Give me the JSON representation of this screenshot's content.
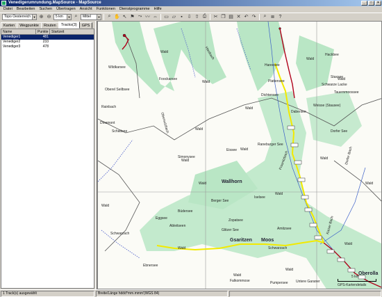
{
  "window": {
    "title": "Venedigerumrundung.MapSource - MapSource",
    "buttons": [
      "_",
      "□",
      "×"
    ]
  },
  "menu": [
    "Datei",
    "Bearbeiten",
    "Suchen",
    "Übertragen",
    "Ansicht",
    "Funktionen",
    "Dienstprogramme",
    "Hilfe"
  ],
  "toolbar": {
    "map_product": "Topo Oesterreich",
    "zoom_scale": "5 km",
    "detail_level": "Mittel"
  },
  "tabs": [
    "Karten",
    "Wegpunkte",
    "Routen",
    "Tracks(3)",
    "GPS"
  ],
  "tracklist": {
    "columns": [
      "Name",
      "Punkte",
      "Startzeit"
    ],
    "rows": [
      {
        "name": "Venediger1",
        "points": "481",
        "start": ""
      },
      {
        "name": "Venediger2",
        "points": "233",
        "start": ""
      },
      {
        "name": "Venediger3",
        "points": "478",
        "start": ""
      }
    ]
  },
  "map": {
    "labels": {
      "wald": "Wald",
      "wallhorn": "Wallhorn",
      "gsaritzen": "Gsaritzen",
      "moos": "Moos",
      "oberolla": "Oberolla",
      "scale": "5 km",
      "gps_detail": "GPS-Kartendetails",
      "hackbee": "Hackbee",
      "staxsee": "Staxsee",
      "schwarze_lacke": "Schwarze Lacke",
      "dabersee": "Dabersee",
      "eissee": "Eissee",
      "simonysee": "Simonysee",
      "berger_see": "Berger See",
      "buedersee": "Büdersee",
      "eggsee": "Eggsee",
      "ableitseen": "Ableitseen",
      "zopatsee": "Zopatsee",
      "glitzer_see": "Glitzer See",
      "amitzsee": "Amitzsee",
      "schwarzach": "Schwarzach",
      "ebnersee": "Ebnersee",
      "falkommose": "Falkommose",
      "pumpersee": "Pumpersee",
      "untere_garaner": "Untere Garaner",
      "iselsee": "Iselsee",
      "tauernmoossee": "Tauernmoossee",
      "weissee": "Weisse (Stausee)",
      "plattensee": "Plattensee",
      "dichtensee": "Dichtensee",
      "haresee": "Hareesee",
      "foockarsee": "Foockarsee",
      "rainbach": "Rainbach",
      "obersulzbach": "Obersulzbach",
      "schattsee": "Schattsee",
      "wildkarsee": "Wildkarsee",
      "oberer_sattelsee": "Oberel Seilbsee",
      "raneburger_see": "Raneburger See",
      "frosnitzbach": "Frosnitzbach",
      "dorfer_see": "Dorfer See",
      "dorferbach": "Dorfer Bach",
      "kaiser": "Kaiser Bach",
      "lanig": "Lanig",
      "stuf": "Stuf",
      "hiesbach": "Hiesbach",
      "kimmichsee": "Kimmichsee",
      "dinemont": "Dinemont"
    },
    "waypoints": [
      "0001",
      "0002",
      "0003",
      "0004",
      "0005",
      "0006",
      "0007",
      "0008",
      "0009",
      "0010",
      "0011",
      "0012",
      "0013",
      "0014",
      "0015"
    ]
  },
  "statusbar": {
    "selection": "1 Track(s) ausgewählt",
    "coords_format": "Breite/Länge hddd°mm.mmm'(WGS 84)"
  },
  "colors": {
    "titlebar": "#0a246a",
    "forest": "#b8e4c4",
    "track_red": "#b0001a",
    "track_yellow": "#f2ea00",
    "river": "#3a5fc8"
  }
}
